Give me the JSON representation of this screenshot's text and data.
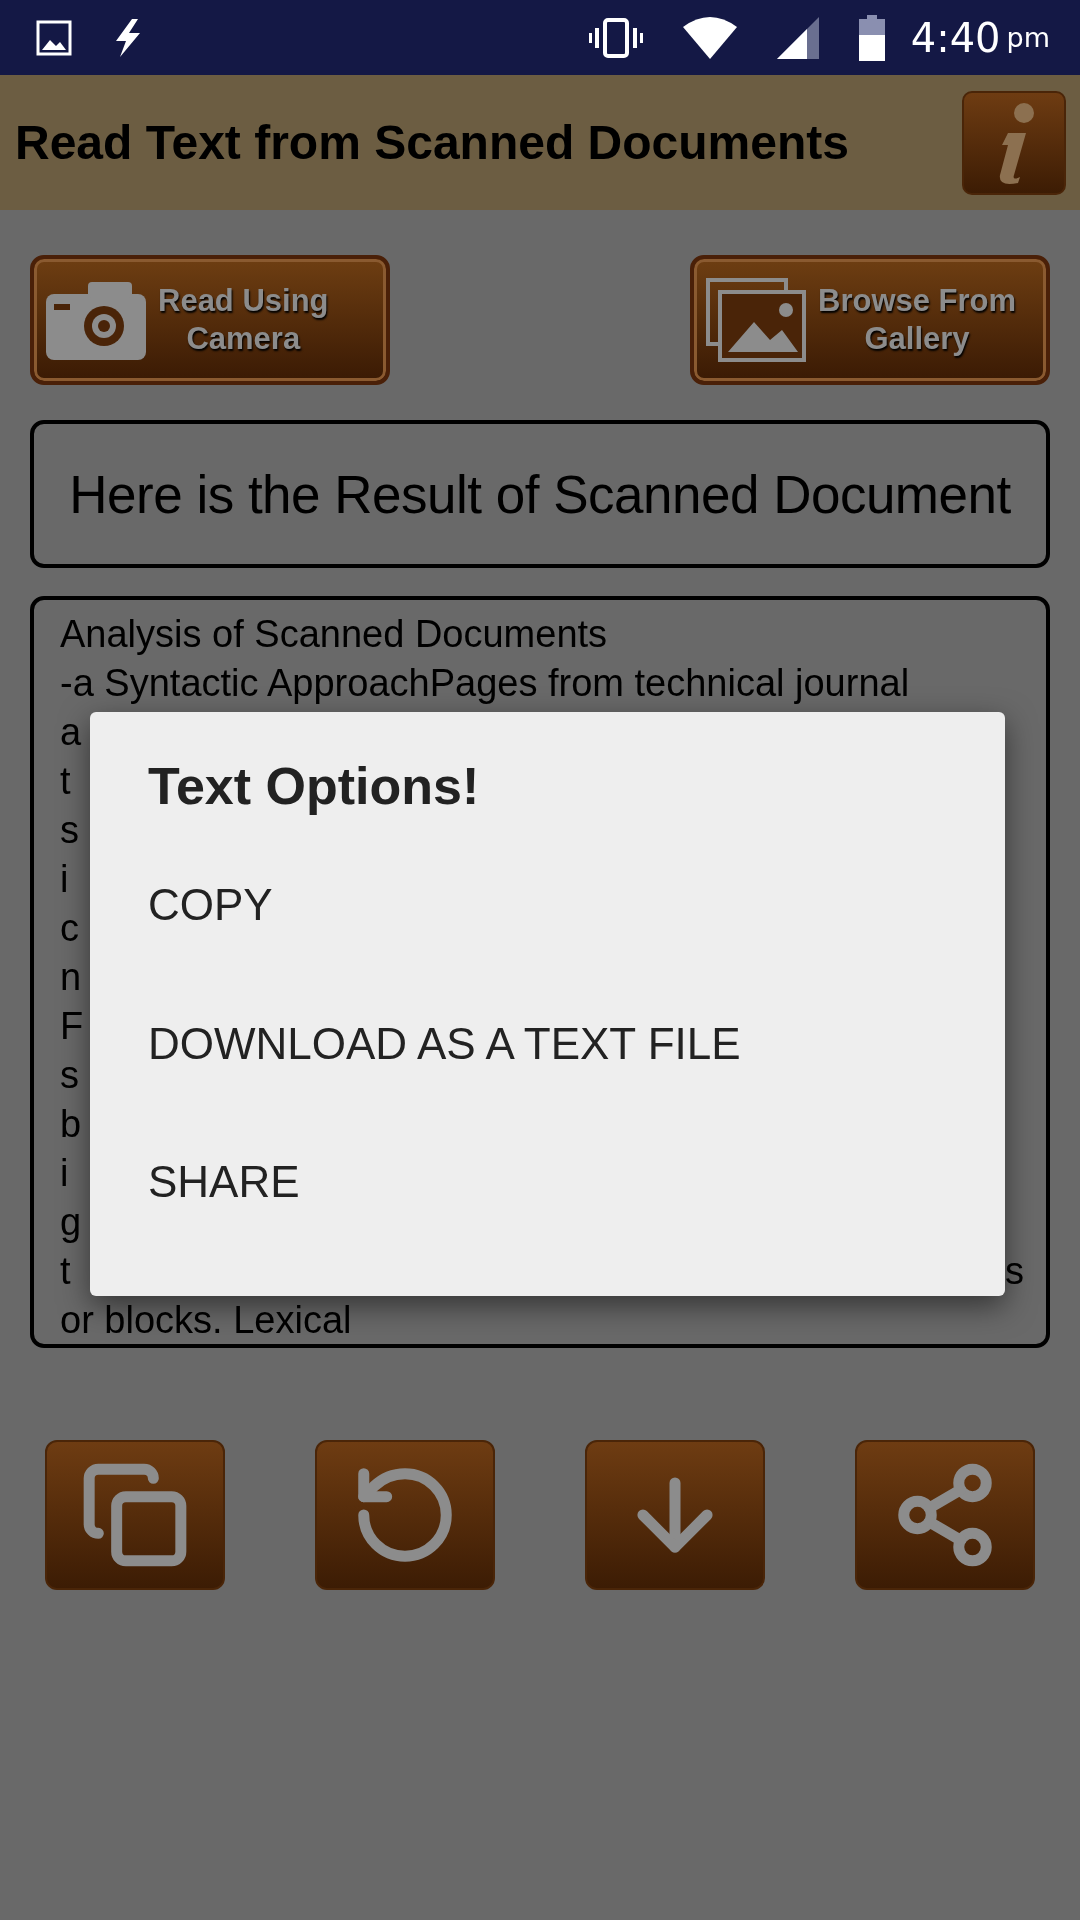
{
  "status_bar": {
    "time": "4:40",
    "ampm": "pm"
  },
  "app_bar": {
    "title": "Read Text from Scanned Documents"
  },
  "actions": [
    {
      "kind": "camera",
      "label": "Read Using\nCamera"
    },
    {
      "kind": "gallery",
      "label": "Browse From\nGallery"
    }
  ],
  "result_heading": "Here is the Result of Scanned Document",
  "result_text": [
    {
      "left": "Analysis of Scanned Documents"
    },
    {
      "left": "-a Syntactic ApproachPages from technical journal"
    },
    {
      "left": "a"
    },
    {
      "left": "t"
    },
    {
      "left": "s"
    },
    {
      "left": "i"
    },
    {
      "left": "c"
    },
    {
      "left": "n"
    },
    {
      "left": "F"
    },
    {
      "left": "s"
    },
    {
      "left": "b"
    },
    {
      "left": "i"
    },
    {
      "left": "g"
    },
    {
      "left": "t",
      "right": "s"
    },
    {
      "left": "or blocks. Lexical"
    }
  ],
  "tools": [
    {
      "kind": "copy"
    },
    {
      "kind": "reset"
    },
    {
      "kind": "download"
    },
    {
      "kind": "share"
    }
  ],
  "dialog": {
    "title": "Text Options!",
    "options": [
      "COPY",
      "DOWNLOAD AS A TEXT FILE",
      "SHARE"
    ]
  }
}
